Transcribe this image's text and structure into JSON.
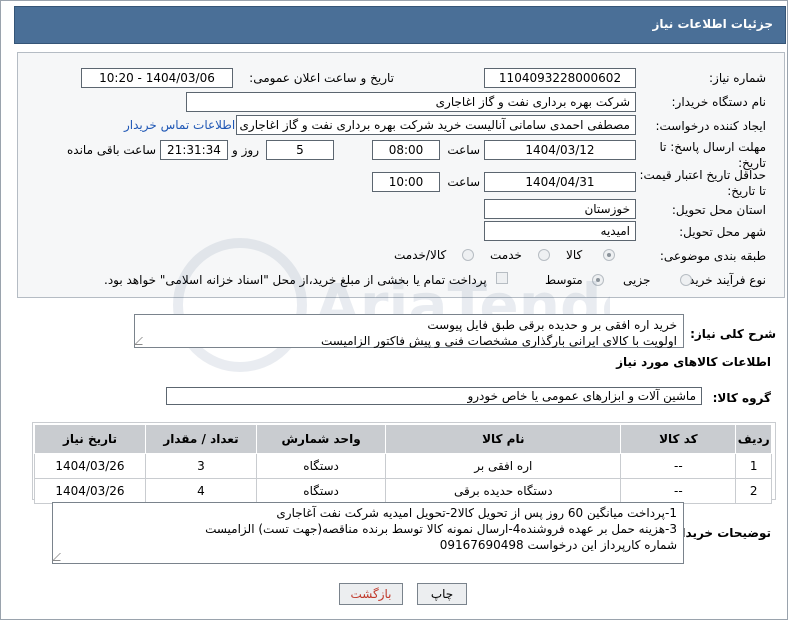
{
  "header": {
    "title": "جزئیات اطلاعات نیاز"
  },
  "labels": {
    "need_number": "شماره نیاز:",
    "announce_datetime": "تاریخ و ساعت اعلان عمومی:",
    "buyer_org": "نام دستگاه خریدار:",
    "requester": "ایجاد کننده درخواست:",
    "reply_deadline": "مهلت ارسال پاسخ: تا تاریخ:",
    "time": "ساعت",
    "days_and": "روز و",
    "remaining": "ساعت باقی مانده",
    "price_validity": "حداقل تاریخ اعتبار قیمت: تا تاریخ:",
    "province": "استان محل تحویل:",
    "city": "شهر محل تحویل:",
    "category": "طبقه بندی موضوعی:",
    "purchase_type": "نوع فرآیند خرید :",
    "description": "شرح کلی نیاز:",
    "goods_info": "اطلاعات کالاهای مورد نیاز",
    "goods_group": "گروه کالا:",
    "buyer_notes": "توضیحات خریدار:"
  },
  "values": {
    "need_number": "1104093228000602",
    "announce_datetime": "1404/03/06 - 10:20",
    "buyer_org": "شرکت بهره برداری نفت و گاز اغاجاری",
    "requester": "مصطفی احمدی سامانی آنالیست خرید شرکت بهره برداری نفت و گاز اغاجاری",
    "contact_link": "اطلاعات تماس خریدار",
    "reply_date": "1404/03/12",
    "reply_time": "08:00",
    "reply_days": "5",
    "reply_remaining": "21:31:34",
    "validity_date": "1404/04/31",
    "validity_time": "10:00",
    "province": "خوزستان",
    "city": "امیدیه",
    "category_options": [
      "کالا",
      "خدمت",
      "کالا/خدمت"
    ],
    "purchase_options": [
      "جزیی",
      "متوسط"
    ],
    "payment_note": "پرداخت تمام یا بخشی از مبلغ خرید،از محل \"اسناد خزانه اسلامی\" خواهد بود.",
    "description_line1": "خرید اره افقی بر و حدیده برقی طبق فایل پیوست",
    "description_line2": "اولویت با کالای ایرانی بارگذاری مشخصات فنی و پیش فاکتور الزامیست",
    "goods_group": "ماشین آلات و ابزارهای عمومی یا خاص خودرو"
  },
  "table": {
    "headers": [
      "ردیف",
      "کد کالا",
      "نام کالا",
      "واحد شمارش",
      "تعداد / مقدار",
      "تاریخ نیاز"
    ],
    "rows": [
      [
        "1",
        "--",
        "اره افقی بر",
        "دستگاه",
        "3",
        "1404/03/26"
      ],
      [
        "2",
        "--",
        "دستگاه حدیده برقی",
        "دستگاه",
        "4",
        "1404/03/26"
      ]
    ]
  },
  "notes": {
    "line1": "1-پرداخت میانگین 60 روز پس از تحویل کالا2-تحویل امیدیه شرکت نفت آغاجاری",
    "line2": "3-هزینه حمل بر عهده فروشنده4-ارسال نمونه کالا توسط برنده مناقصه(جهت تست) الزامیست",
    "line3": "شماره کارپرداز این درخواست 09167690498"
  },
  "buttons": {
    "print": "چاپ",
    "back": "بازگشت"
  },
  "colors": {
    "header_bg": "#4a6f97",
    "link": "#1f57b5",
    "back_text": "#c0392b"
  }
}
